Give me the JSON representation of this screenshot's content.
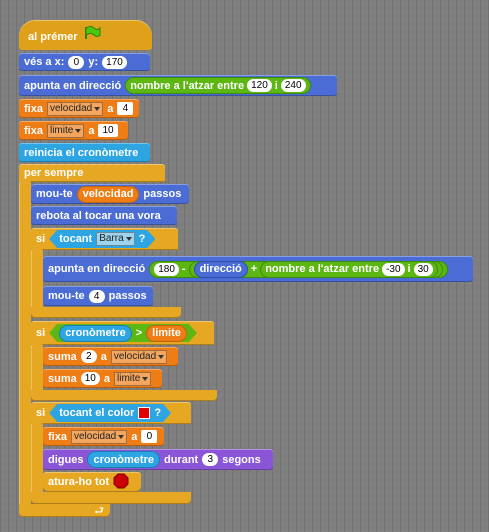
{
  "hat": {
    "label": "al prémer",
    "icon": "green-flag-icon"
  },
  "goto": {
    "label": "vés a x:",
    "x": "0",
    "y_label": "y:",
    "y": "170"
  },
  "point1": {
    "label": "apunta en direcció",
    "random": {
      "label": "nombre a l'atzar entre",
      "from": "120",
      "sep": "i",
      "to": "240"
    }
  },
  "set1": {
    "label": "fixa",
    "var": "velocidad",
    "to": "a",
    "value": "4"
  },
  "set2": {
    "label": "fixa",
    "var": "limite",
    "to": "a",
    "value": "10"
  },
  "reset": {
    "label": "reinicia el cronòmetre"
  },
  "forever": {
    "label": "per sempre"
  },
  "move1": {
    "label": "mou-te",
    "var": "velocidad",
    "suffix": "passos"
  },
  "bounce": {
    "label": "rebota al tocar una vora"
  },
  "if1": {
    "label": "si",
    "cond": {
      "label": "tocant",
      "target": "Barra",
      "q": "?"
    },
    "point2": {
      "label": "apunta en direcció",
      "v1": "180",
      "minus": "-",
      "dir": "direcció",
      "plus": "+",
      "random": {
        "label": "nombre a l'atzar entre",
        "from": "-30",
        "sep": "i",
        "to": "30"
      }
    },
    "move2": {
      "label": "mou-te",
      "value": "4",
      "suffix": "passos"
    }
  },
  "if2": {
    "label": "si",
    "cond": {
      "left": "cronòmetre",
      "op": ">",
      "right": "limite"
    },
    "change1": {
      "label": "suma",
      "value": "2",
      "to": "a",
      "var": "velocidad"
    },
    "change2": {
      "label": "suma",
      "value": "10",
      "to": "a",
      "var": "limite"
    }
  },
  "if3": {
    "label": "si",
    "cond": {
      "label": "tocant el color",
      "q": "?",
      "color": "#e00000"
    },
    "set3": {
      "label": "fixa",
      "var": "velocidad",
      "to": "a",
      "value": "0"
    },
    "say": {
      "label": "digues",
      "reporter": "cronòmetre",
      "during": "durant",
      "secs": "3",
      "unit": "segons"
    },
    "stop": {
      "label": "atura-ho tot",
      "icon": "stop-sign-icon"
    }
  },
  "loop_arrow": "⮐"
}
